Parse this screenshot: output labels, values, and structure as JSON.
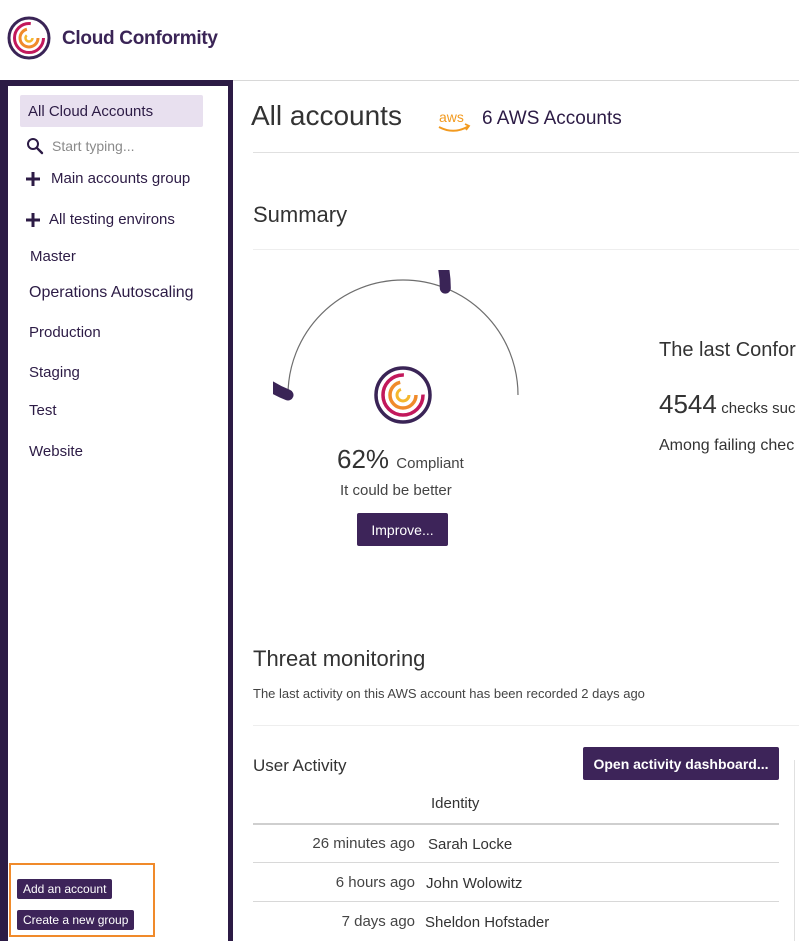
{
  "app": {
    "brand": "Cloud Conformity"
  },
  "sidebar": {
    "active_item": "All Cloud Accounts",
    "search_placeholder": "Start typing...",
    "groups": [
      "Main accounts group",
      "All testing environs"
    ],
    "accounts": [
      "Master",
      "Operations Autoscaling",
      "Production",
      "Staging",
      "Test",
      "Website"
    ],
    "add_account_label": "Add an account",
    "create_group_label": "Create a new group"
  },
  "header": {
    "page_title": "All accounts",
    "aws_logo_text": "aws",
    "aws_count": "6 AWS Accounts"
  },
  "summary": {
    "title": "Summary",
    "compliance_percent": 62,
    "percent_text": "62%",
    "percent_label": "Compliant",
    "status_text": "It could be better",
    "improve_label": "Improve...",
    "last_conformity_text": "The last Confor",
    "checks_count": "4544",
    "checks_text": "checks suc",
    "failing_text": "Among failing chec"
  },
  "threat": {
    "title": "Threat monitoring",
    "subtitle": "The last activity on this AWS account has been recorded 2 days ago",
    "user_activity_title": "User Activity",
    "open_dashboard_label": "Open activity dashboard...",
    "identity_header": "Identity",
    "rows": [
      {
        "time": "26 minutes ago",
        "identity": "Sarah Locke"
      },
      {
        "time": "6 hours ago",
        "identity": "John Wolowitz"
      },
      {
        "time": "7 days ago",
        "identity": "Sheldon Hofstader"
      }
    ]
  },
  "colors": {
    "brand_dark": "#2c1b45",
    "button": "#3d2459",
    "active_item_bg": "#e8e0ef",
    "highlight_border": "#f08a2a",
    "aws_orange": "#f29a1f"
  }
}
